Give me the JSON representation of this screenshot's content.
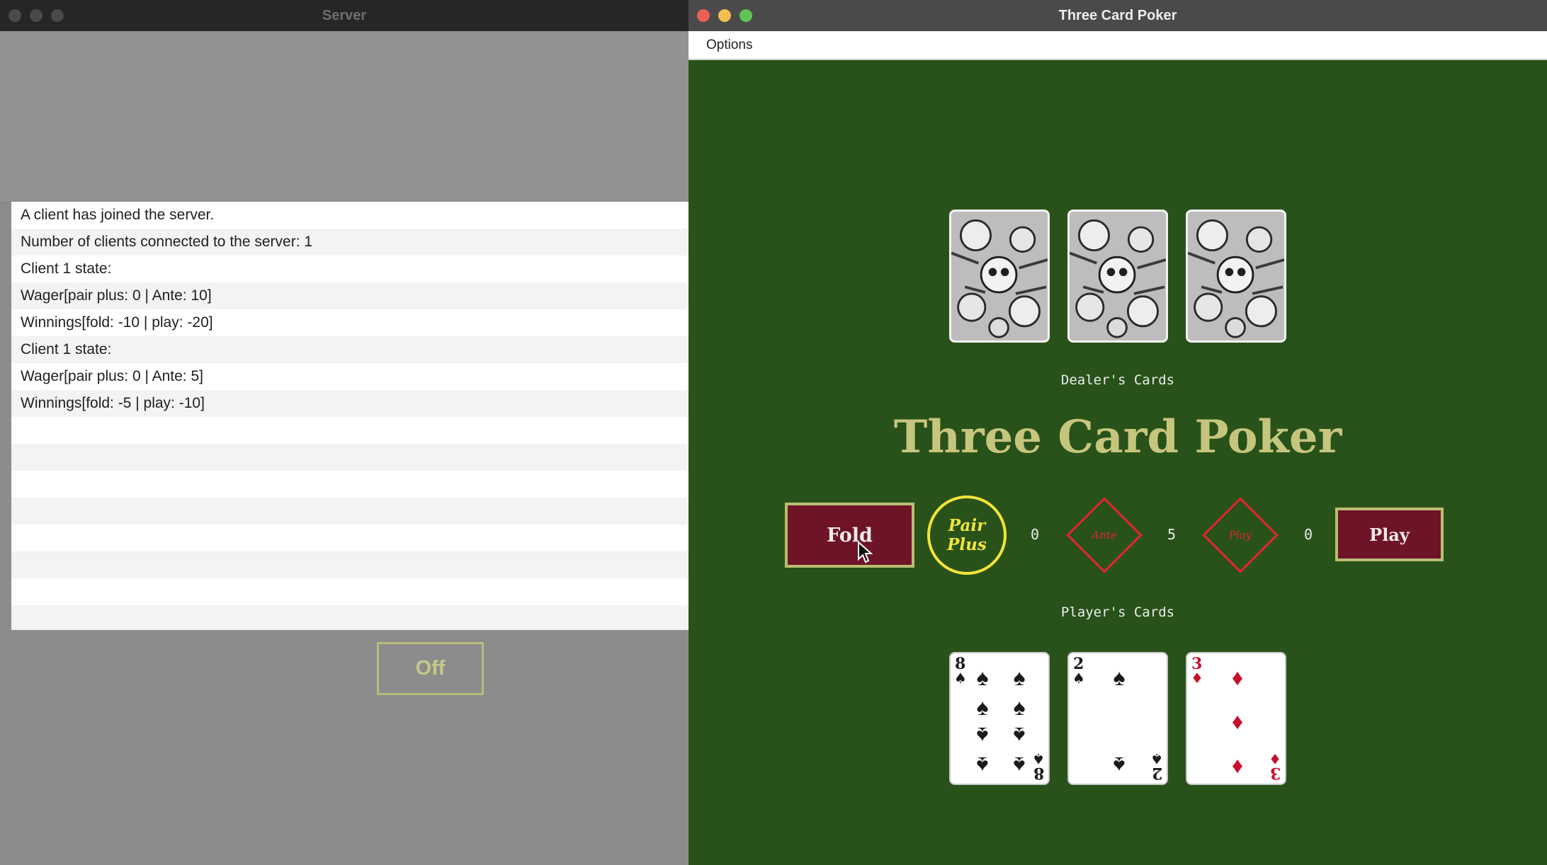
{
  "server": {
    "title": "Server",
    "log": [
      "A client has joined the server.",
      "Number of clients connected to the server: 1",
      "Client 1 state:",
      "Wager[pair plus: 0 | Ante: 10]",
      "Winnings[fold: -10 | play: -20]",
      "Client 1 state:",
      "Wager[pair plus: 0 | Ante: 5]",
      "Winnings[fold: -5 | play: -10]"
    ],
    "off_label": "Off"
  },
  "poker": {
    "title": "Three Card Poker",
    "menu": {
      "options_label": "Options"
    },
    "dealer_label": "Dealer's Cards",
    "player_label": "Player's Cards",
    "game_title": "Three Card Poker",
    "buttons": {
      "fold": "Fold",
      "play": "Play"
    },
    "pair_plus": {
      "line1": "Pair",
      "line2": "Plus"
    },
    "ante_label": "Ante",
    "play_bet_label": "Play",
    "bets": {
      "pair_plus": "0",
      "ante": "5",
      "play": "0"
    },
    "player_cards": [
      {
        "rank": "8",
        "suit": "♠",
        "color": "#1b1b1b"
      },
      {
        "rank": "2",
        "suit": "♠",
        "color": "#1b1b1b"
      },
      {
        "rank": "3",
        "suit": "♦",
        "color": "#c8102e"
      }
    ]
  },
  "colors": {
    "felt": "#285219",
    "button_wine": "#6e1427",
    "button_border": "#b9bd72",
    "title_gold": "#c6c57d",
    "pair_plus_yellow": "#f2e43a",
    "diamond_red": "#e6252e"
  }
}
